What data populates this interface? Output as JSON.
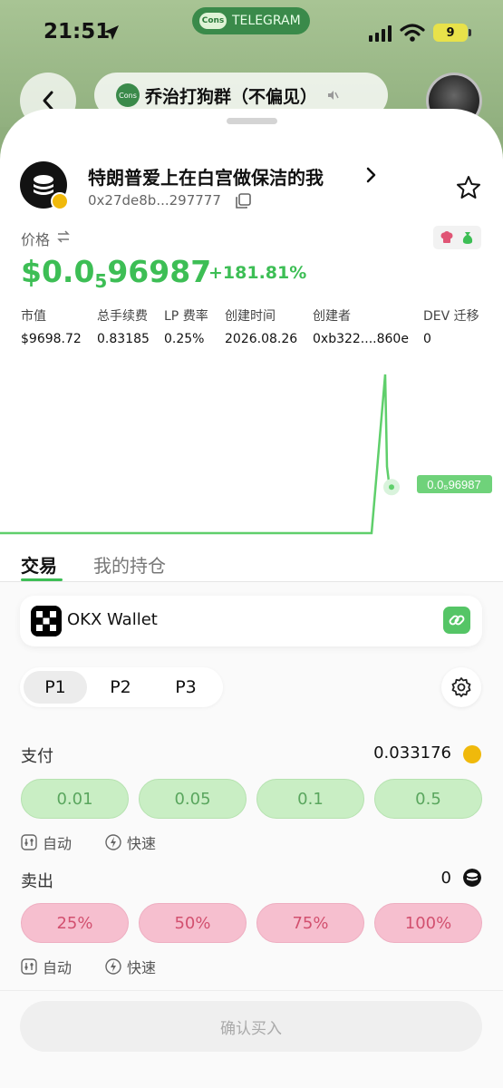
{
  "status_bar": {
    "time": "21:51",
    "telegram_pill": "TELEGRAM",
    "telegram_logo": "Cons",
    "battery": "9"
  },
  "chat_header": {
    "title": "乔治打狗群（不偏见）",
    "logo": "Cons"
  },
  "token": {
    "name": "特朗普爱上在白宫做保洁的我",
    "address": "0x27de8b...297777",
    "price_label": "价格",
    "price_prefix": "$0.0",
    "price_subscript": "5",
    "price_digits": "96987",
    "price_change": "+181.81%"
  },
  "stats": [
    {
      "label": "市值",
      "value": "$9698.72"
    },
    {
      "label": "总手续费",
      "value": "0.83185"
    },
    {
      "label": "LP 费率",
      "value": "0.25%"
    },
    {
      "label": "创建时间",
      "value": "2026.08.26"
    },
    {
      "label": "创建者",
      "value": "0xb322....860e"
    },
    {
      "label": "DEV 迁移",
      "value": "0"
    }
  ],
  "chart_data": {
    "type": "line",
    "series": [
      {
        "values": [
          0,
          0,
          0,
          0,
          0,
          0,
          1.0,
          0.42,
          0.28,
          0.29
        ]
      }
    ],
    "last_price_label": "0.0₅96987",
    "colors": {
      "line": "#5fcf6b",
      "label_bg": "#6fd27a"
    }
  },
  "tabs": {
    "trade": "交易",
    "holdings": "我的持仓"
  },
  "wallet": {
    "name": "OKX Wallet"
  },
  "presets": [
    "P1",
    "P2",
    "P3"
  ],
  "pay": {
    "label": "支付",
    "balance": "0.033176",
    "amounts": [
      "0.01",
      "0.05",
      "0.1",
      "0.5"
    ],
    "mode_auto": "自动",
    "mode_fast": "快速"
  },
  "sell": {
    "label": "卖出",
    "balance": "0",
    "amounts": [
      "25%",
      "50%",
      "75%",
      "100%"
    ],
    "mode_auto": "自动",
    "mode_fast": "快速"
  },
  "confirm": {
    "label": "确认买入"
  },
  "colors": {
    "accent_green": "#3dbe55",
    "buy_bg": "#c9eec4",
    "sell_bg": "#f6bfcf"
  }
}
